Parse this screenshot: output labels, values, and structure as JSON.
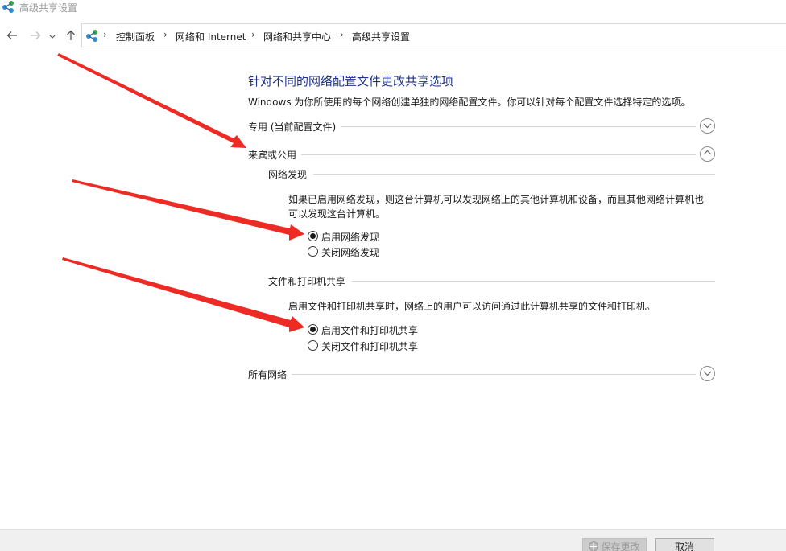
{
  "window": {
    "title": "高级共享设置"
  },
  "nav": {
    "back_icon": "back-arrow-icon",
    "forward_icon": "forward-arrow-icon",
    "recent_icon": "chevron-down-icon",
    "up_icon": "up-arrow-icon"
  },
  "breadcrumb": {
    "items": [
      "控制面板",
      "网络和 Internet",
      "网络和共享中心",
      "高级共享设置"
    ],
    "separator": "›"
  },
  "page": {
    "heading": "针对不同的网络配置文件更改共享选项",
    "subtitle": "Windows 为你所使用的每个网络创建单独的网络配置文件。你可以针对每个配置文件选择特定的选项。"
  },
  "sections": {
    "private": {
      "label": "专用 (当前配置文件)",
      "state": "collapsed"
    },
    "guest_public": {
      "label": "来宾或公用",
      "state": "expanded"
    },
    "all_networks": {
      "label": "所有网络",
      "state": "collapsed"
    }
  },
  "network_discovery": {
    "title": "网络发现",
    "description": "如果已启用网络发现，则这台计算机可以发现网络上的其他计算机和设备，而且其他网络计算机也可以发现这台计算机。",
    "options": [
      {
        "label": "启用网络发现",
        "checked": true
      },
      {
        "label": "关闭网络发现",
        "checked": false
      }
    ]
  },
  "file_printer_sharing": {
    "title": "文件和打印机共享",
    "description": "启用文件和打印机共享时，网络上的用户可以访问通过此计算机共享的文件和打印机。",
    "options": [
      {
        "label": "启用文件和打印机共享",
        "checked": true
      },
      {
        "label": "关闭文件和打印机共享",
        "checked": false
      }
    ]
  },
  "footer": {
    "save_label": "保存更改",
    "cancel_label": "取消"
  },
  "colors": {
    "heading": "#1e3287",
    "annotation_arrow": "#ee2a24"
  }
}
